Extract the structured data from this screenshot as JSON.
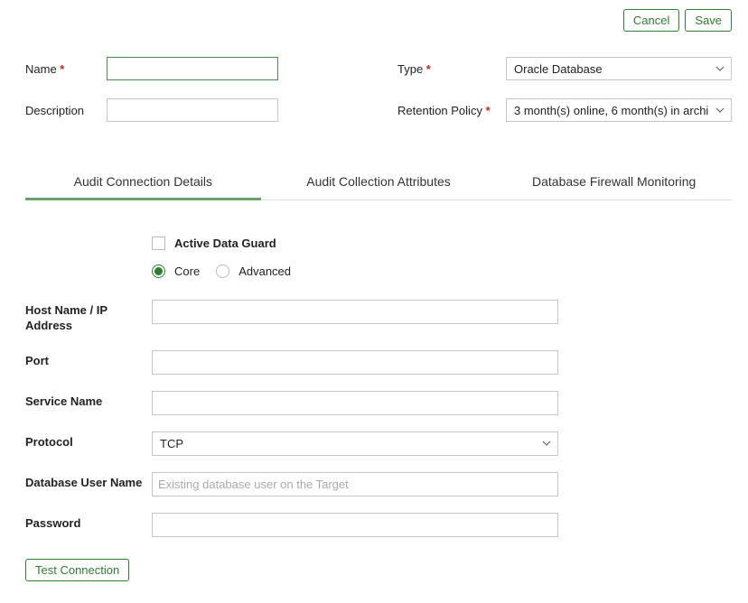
{
  "buttons": {
    "cancel": "Cancel",
    "save": "Save",
    "test_connection": "Test Connection"
  },
  "top_fields": {
    "name_label": "Name",
    "name_value": "",
    "description_label": "Description",
    "description_value": "",
    "type_label": "Type",
    "type_value": "Oracle Database",
    "retention_label": "Retention Policy",
    "retention_value": "3 month(s) online, 6 month(s) in archi"
  },
  "tabs": {
    "audit_connection": "Audit Connection Details",
    "audit_collection": "Audit Collection Attributes",
    "firewall": "Database Firewall Monitoring"
  },
  "options": {
    "active_data_guard": "Active Data Guard",
    "core": "Core",
    "advanced": "Advanced"
  },
  "fields": {
    "host_label": "Host Name / IP Address",
    "host_value": "",
    "port_label": "Port",
    "port_value": "",
    "service_label": "Service Name",
    "service_value": "",
    "protocol_label": "Protocol",
    "protocol_value": "TCP",
    "dbuser_label": "Database User Name",
    "dbuser_value": "",
    "dbuser_placeholder": "Existing database user on the Target",
    "password_label": "Password",
    "password_value": ""
  }
}
